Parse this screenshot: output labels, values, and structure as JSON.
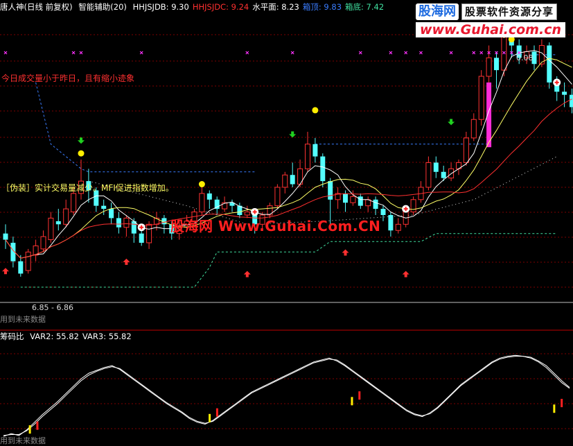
{
  "header": {
    "name": "唐人神(日线 前复权)",
    "indicator": "智能辅助(20)",
    "items": [
      {
        "label": "HHJSJDB: 9.30",
        "color": "#ffffff"
      },
      {
        "label": "HHJSJDC: 9.24",
        "color": "#ff3030"
      },
      {
        "label": "水平面: 8.23",
        "color": "#ffffff"
      },
      {
        "label": "箱顶: 9.83",
        "color": "#3a7dff"
      },
      {
        "label": "箱底: 7.42",
        "color": "#40e0a0"
      }
    ]
  },
  "logo": {
    "brand": "股海网",
    "tagline": "股票软件资源分享",
    "url": "www.Guhai.com.cn"
  },
  "annotations": {
    "volume_note": "今日成交量小于昨日，且有缩小迹象",
    "fake_note": "［伪装］实计交易量减少。MFI促进指数增加。",
    "watermark": "股海网 Www.Guhai.Com.CN",
    "range": "6.85 - 6.86",
    "future_main": "用到未来数据",
    "future_sub": "用到未来数据",
    "peak": "0.08"
  },
  "sub_header": {
    "name": "筹码比",
    "items": [
      {
        "label": "VAR2: 55.82",
        "color": "#ffffff"
      },
      {
        "label": "VAR3: 55.82",
        "color": "#ffffff"
      }
    ]
  },
  "colors": {
    "up": "#ff3232",
    "down": "#54ffff",
    "ma_fast": "#ffffff",
    "ma_mid": "#ffff66",
    "ma_slow": "#ff3030",
    "box_top": "#3a7dff",
    "box_bottom": "#40e0a0",
    "grid": "#800000"
  },
  "chart_data": {
    "type": "candlestick",
    "ylim": [
      6.5,
      11.0
    ],
    "candles": [
      {
        "o": 7.55,
        "c": 7.45,
        "h": 7.7,
        "l": 7.3
      },
      {
        "o": 7.4,
        "c": 7.1,
        "h": 7.5,
        "l": 7.0
      },
      {
        "o": 7.1,
        "c": 6.9,
        "h": 7.2,
        "l": 6.85
      },
      {
        "o": 6.95,
        "c": 7.25,
        "h": 7.3,
        "l": 6.9
      },
      {
        "o": 7.2,
        "c": 7.35,
        "h": 7.45,
        "l": 7.1
      },
      {
        "o": 7.3,
        "c": 7.5,
        "h": 7.6,
        "l": 7.25
      },
      {
        "o": 7.45,
        "c": 7.8,
        "h": 7.9,
        "l": 7.4
      },
      {
        "o": 7.75,
        "c": 7.7,
        "h": 7.95,
        "l": 7.6
      },
      {
        "o": 7.7,
        "c": 7.95,
        "h": 8.1,
        "l": 7.65
      },
      {
        "o": 7.9,
        "c": 8.2,
        "h": 8.3,
        "l": 7.85
      },
      {
        "o": 8.2,
        "c": 8.4,
        "h": 8.75,
        "l": 8.1
      },
      {
        "o": 8.4,
        "c": 8.25,
        "h": 8.6,
        "l": 8.05
      },
      {
        "o": 8.25,
        "c": 8.0,
        "h": 8.3,
        "l": 7.9
      },
      {
        "o": 8.0,
        "c": 7.95,
        "h": 8.1,
        "l": 7.85
      },
      {
        "o": 7.95,
        "c": 7.8,
        "h": 8.05,
        "l": 7.7
      },
      {
        "o": 7.8,
        "c": 7.65,
        "h": 7.9,
        "l": 7.55
      },
      {
        "o": 7.65,
        "c": 7.8,
        "h": 7.85,
        "l": 7.5
      },
      {
        "o": 7.75,
        "c": 7.55,
        "h": 7.8,
        "l": 7.4
      },
      {
        "o": 7.55,
        "c": 7.4,
        "h": 7.7,
        "l": 7.35
      },
      {
        "o": 7.4,
        "c": 7.7,
        "h": 7.75,
        "l": 7.3
      },
      {
        "o": 7.7,
        "c": 7.8,
        "h": 7.9,
        "l": 7.6
      },
      {
        "o": 7.8,
        "c": 7.7,
        "h": 7.85,
        "l": 7.55
      },
      {
        "o": 7.7,
        "c": 7.55,
        "h": 7.75,
        "l": 7.45
      },
      {
        "o": 7.55,
        "c": 7.65,
        "h": 7.75,
        "l": 7.45
      },
      {
        "o": 7.65,
        "c": 7.75,
        "h": 7.85,
        "l": 7.6
      },
      {
        "o": 7.75,
        "c": 7.9,
        "h": 7.95,
        "l": 7.7
      },
      {
        "o": 7.9,
        "c": 8.2,
        "h": 8.3,
        "l": 7.85
      },
      {
        "o": 8.2,
        "c": 8.1,
        "h": 8.25,
        "l": 7.95
      },
      {
        "o": 8.1,
        "c": 7.95,
        "h": 8.15,
        "l": 7.85
      },
      {
        "o": 7.95,
        "c": 8.05,
        "h": 8.15,
        "l": 7.9
      },
      {
        "o": 8.05,
        "c": 8.0,
        "h": 8.1,
        "l": 7.9
      },
      {
        "o": 8.0,
        "c": 7.85,
        "h": 8.05,
        "l": 7.8
      },
      {
        "o": 7.85,
        "c": 7.9,
        "h": 8.0,
        "l": 7.8
      },
      {
        "o": 7.9,
        "c": 7.7,
        "h": 7.95,
        "l": 7.55
      },
      {
        "o": 7.7,
        "c": 7.85,
        "h": 7.9,
        "l": 7.6
      },
      {
        "o": 7.85,
        "c": 8.0,
        "h": 8.05,
        "l": 7.8
      },
      {
        "o": 8.0,
        "c": 8.3,
        "h": 8.35,
        "l": 7.95
      },
      {
        "o": 8.3,
        "c": 8.5,
        "h": 8.55,
        "l": 8.2
      },
      {
        "o": 8.5,
        "c": 8.35,
        "h": 8.7,
        "l": 8.3
      },
      {
        "o": 8.35,
        "c": 8.6,
        "h": 8.75,
        "l": 8.3
      },
      {
        "o": 8.6,
        "c": 9.0,
        "h": 9.2,
        "l": 8.55
      },
      {
        "o": 9.0,
        "c": 8.8,
        "h": 9.1,
        "l": 8.7
      },
      {
        "o": 8.8,
        "c": 8.4,
        "h": 8.85,
        "l": 8.3
      },
      {
        "o": 8.4,
        "c": 8.1,
        "h": 8.45,
        "l": 7.6
      },
      {
        "o": 8.1,
        "c": 8.2,
        "h": 8.3,
        "l": 7.95
      },
      {
        "o": 8.2,
        "c": 8.05,
        "h": 8.25,
        "l": 7.9
      },
      {
        "o": 8.05,
        "c": 8.15,
        "h": 8.25,
        "l": 8.0
      },
      {
        "o": 8.15,
        "c": 8.0,
        "h": 8.2,
        "l": 7.95
      },
      {
        "o": 8.0,
        "c": 8.1,
        "h": 8.15,
        "l": 7.9
      },
      {
        "o": 8.1,
        "c": 7.95,
        "h": 8.15,
        "l": 7.85
      },
      {
        "o": 7.95,
        "c": 7.85,
        "h": 8.0,
        "l": 7.75
      },
      {
        "o": 7.85,
        "c": 7.6,
        "h": 7.9,
        "l": 7.5
      },
      {
        "o": 7.6,
        "c": 7.7,
        "h": 7.8,
        "l": 7.55
      },
      {
        "o": 7.7,
        "c": 7.9,
        "h": 8.0,
        "l": 7.65
      },
      {
        "o": 7.9,
        "c": 8.1,
        "h": 8.15,
        "l": 7.85
      },
      {
        "o": 8.1,
        "c": 8.3,
        "h": 8.4,
        "l": 8.05
      },
      {
        "o": 8.3,
        "c": 8.7,
        "h": 8.8,
        "l": 8.25
      },
      {
        "o": 8.7,
        "c": 8.55,
        "h": 8.8,
        "l": 8.45
      },
      {
        "o": 8.55,
        "c": 8.45,
        "h": 8.65,
        "l": 8.4
      },
      {
        "o": 8.45,
        "c": 8.6,
        "h": 8.7,
        "l": 8.4
      },
      {
        "o": 8.6,
        "c": 8.7,
        "h": 8.75,
        "l": 8.5
      },
      {
        "o": 8.7,
        "c": 9.1,
        "h": 9.2,
        "l": 8.65
      },
      {
        "o": 9.1,
        "c": 9.4,
        "h": 9.5,
        "l": 9.05
      },
      {
        "o": 9.4,
        "c": 10.1,
        "h": 10.2,
        "l": 9.3
      },
      {
        "o": 10.1,
        "c": 10.4,
        "h": 10.6,
        "l": 10.0
      },
      {
        "o": 10.4,
        "c": 10.2,
        "h": 10.5,
        "l": 9.9
      },
      {
        "o": 10.2,
        "c": 10.8,
        "h": 10.95,
        "l": 10.1
      },
      {
        "o": 10.8,
        "c": 10.6,
        "h": 10.9,
        "l": 10.4
      },
      {
        "o": 10.6,
        "c": 10.4,
        "h": 10.7,
        "l": 10.3
      },
      {
        "o": 10.4,
        "c": 10.5,
        "h": 10.6,
        "l": 10.3
      },
      {
        "o": 10.5,
        "c": 10.3,
        "h": 10.6,
        "l": 10.2
      },
      {
        "o": 10.3,
        "c": 10.6,
        "h": 10.7,
        "l": 10.25
      },
      {
        "o": 10.6,
        "c": 10.0,
        "h": 10.65,
        "l": 9.9
      },
      {
        "o": 10.0,
        "c": 9.85,
        "h": 10.1,
        "l": 9.7
      },
      {
        "o": 9.85,
        "c": 9.8,
        "h": 10.0,
        "l": 9.6
      },
      {
        "o": 9.8,
        "c": 9.6,
        "h": 9.9,
        "l": 9.5
      }
    ],
    "sub_series": [
      {
        "name": "VAR2",
        "values": [
          5,
          8,
          6,
          12,
          20,
          28,
          35,
          42,
          50,
          58,
          66,
          72,
          75,
          78,
          80,
          76,
          70,
          64,
          58,
          52,
          46,
          40,
          35,
          30,
          24,
          20,
          18,
          22,
          28,
          34,
          40,
          46,
          52,
          56,
          60,
          64,
          68,
          72,
          76,
          80,
          84,
          86,
          88,
          85,
          80,
          74,
          68,
          62,
          56,
          50,
          44,
          38,
          32,
          28,
          26,
          30,
          36,
          44,
          52,
          60,
          66,
          72,
          78,
          84,
          88,
          90,
          91,
          90,
          88,
          84,
          78,
          70,
          62,
          56
        ]
      },
      {
        "name": "VAR3",
        "values": [
          6,
          7,
          7,
          11,
          18,
          26,
          33,
          40,
          48,
          56,
          64,
          70,
          74,
          77,
          79,
          77,
          71,
          65,
          59,
          53,
          47,
          41,
          36,
          31,
          25,
          21,
          19,
          21,
          27,
          33,
          39,
          45,
          51,
          55,
          59,
          63,
          67,
          71,
          75,
          79,
          83,
          85,
          87,
          86,
          81,
          75,
          69,
          63,
          57,
          51,
          45,
          39,
          33,
          29,
          27,
          29,
          35,
          43,
          51,
          59,
          65,
          71,
          77,
          83,
          87,
          89,
          90,
          90,
          89,
          85,
          80,
          72,
          64,
          57
        ]
      }
    ]
  }
}
